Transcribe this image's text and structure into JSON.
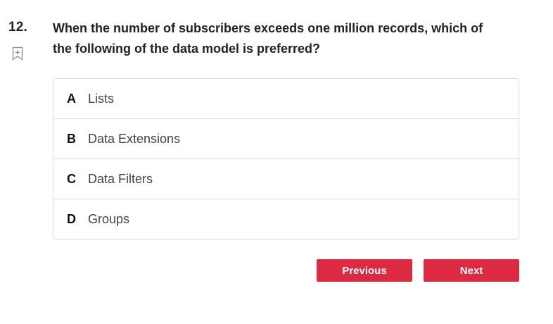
{
  "question": {
    "number": "12.",
    "text": "When the number of subscribers exceeds one million records, which of the following of the data model is preferred?"
  },
  "options": [
    {
      "letter": "A",
      "text": "Lists"
    },
    {
      "letter": "B",
      "text": "Data Extensions"
    },
    {
      "letter": "C",
      "text": "Data Filters"
    },
    {
      "letter": "D",
      "text": "Groups"
    }
  ],
  "buttons": {
    "previous": "Previous",
    "next": "Next"
  },
  "colors": {
    "button_bg": "#dc2a43",
    "button_text": "#ffffff",
    "border": "#dcdcdc"
  },
  "icons": {
    "bookmark": "bookmark-add-icon"
  }
}
